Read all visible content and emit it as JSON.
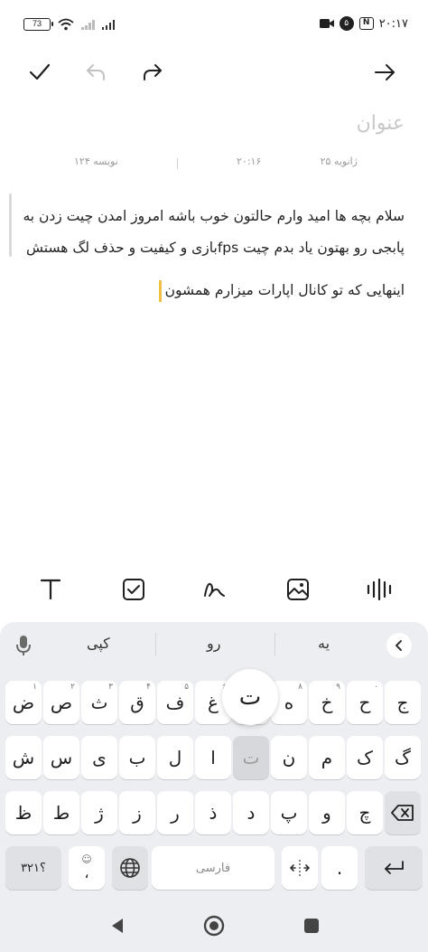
{
  "status_bar": {
    "battery": "73",
    "time": "۲۰:۱۷",
    "notification_badge": "۵",
    "nfc_label": "N"
  },
  "toolbar": {
    "confirm_icon": "check-icon",
    "undo_icon": "undo-icon",
    "redo_icon": "redo-icon",
    "forward_icon": "arrow-right-icon"
  },
  "note": {
    "title_placeholder": "عنوان",
    "date": "۲۵ ژانویه",
    "time": "۲۰:۱۶",
    "char_count": "۱۲۴ نویسه",
    "paragraph_1": "سلام بچه ها امید وارم حالتون خوب باشه امروز امدن چیت زدن به پابجی رو بهتون یاد بدم چیت fpsبازی و کیفیت و حذف لگ هستش",
    "paragraph_2": "اینهایی که تو کانال اپارات میزارم همشون",
    "caret_color": "#f0c040"
  },
  "format_bar": {
    "text_icon": "text-format-icon",
    "checklist_icon": "checkbox-icon",
    "draw_icon": "scribble-icon",
    "image_icon": "image-icon",
    "audio_icon": "audio-waveform-icon"
  },
  "keyboard": {
    "suggestions": [
      "یه",
      "رو",
      "کپی"
    ],
    "row1": [
      {
        "char": "ض",
        "num": "۱"
      },
      {
        "char": "ص",
        "num": "۲"
      },
      {
        "char": "ث",
        "num": "۳"
      },
      {
        "char": "ق",
        "num": "۴"
      },
      {
        "char": "ف",
        "num": "۵"
      },
      {
        "char": "غ",
        "num": "۶"
      },
      {
        "char": "ع",
        "num": "۷"
      },
      {
        "char": "ه",
        "num": "۸"
      },
      {
        "char": "خ",
        "num": "۹"
      },
      {
        "char": "ح",
        "num": "۰"
      },
      {
        "char": "ج",
        "num": ""
      }
    ],
    "row2": [
      "ش",
      "س",
      "ی",
      "ب",
      "ل",
      "ا",
      "ت",
      "ن",
      "م",
      "ک",
      "گ"
    ],
    "row3": [
      "ظ",
      "ط",
      "ژ",
      "ز",
      "ر",
      "ذ",
      "د",
      "پ",
      "و",
      "چ"
    ],
    "popup_char": "ت",
    "symbols_label": "؟۳۲۱",
    "comma": "،",
    "space_label": "فارسی",
    "period": ".",
    "emoji_icon": "emoji-icon",
    "globe_icon": "globe-icon",
    "cursor_icon": "cursor-move-icon",
    "enter_icon": "enter-icon",
    "backspace_icon": "backspace-icon",
    "mic_icon": "mic-icon",
    "collapse_icon": "chevron-left-icon"
  },
  "navbar": {
    "back_icon": "back-triangle-icon",
    "home_icon": "home-circle-icon",
    "recents_icon": "recents-square-icon"
  }
}
